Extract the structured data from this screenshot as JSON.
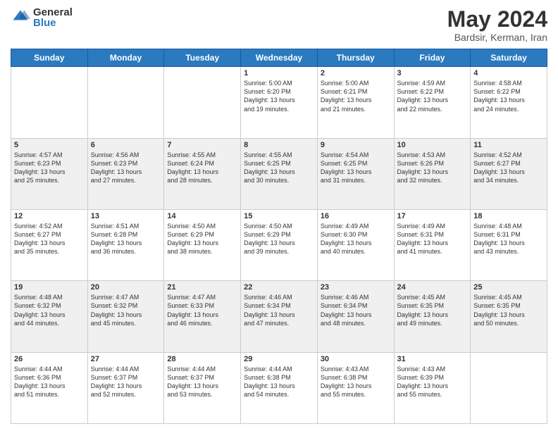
{
  "header": {
    "logo_general": "General",
    "logo_blue": "Blue",
    "month_title": "May 2024",
    "location": "Bardsir, Kerman, Iran"
  },
  "weekdays": [
    "Sunday",
    "Monday",
    "Tuesday",
    "Wednesday",
    "Thursday",
    "Friday",
    "Saturday"
  ],
  "weeks": [
    [
      {
        "day": "",
        "info": ""
      },
      {
        "day": "",
        "info": ""
      },
      {
        "day": "",
        "info": ""
      },
      {
        "day": "1",
        "info": "Sunrise: 5:00 AM\nSunset: 6:20 PM\nDaylight: 13 hours\nand 19 minutes."
      },
      {
        "day": "2",
        "info": "Sunrise: 5:00 AM\nSunset: 6:21 PM\nDaylight: 13 hours\nand 21 minutes."
      },
      {
        "day": "3",
        "info": "Sunrise: 4:59 AM\nSunset: 6:22 PM\nDaylight: 13 hours\nand 22 minutes."
      },
      {
        "day": "4",
        "info": "Sunrise: 4:58 AM\nSunset: 6:22 PM\nDaylight: 13 hours\nand 24 minutes."
      }
    ],
    [
      {
        "day": "5",
        "info": "Sunrise: 4:57 AM\nSunset: 6:23 PM\nDaylight: 13 hours\nand 25 minutes."
      },
      {
        "day": "6",
        "info": "Sunrise: 4:56 AM\nSunset: 6:23 PM\nDaylight: 13 hours\nand 27 minutes."
      },
      {
        "day": "7",
        "info": "Sunrise: 4:55 AM\nSunset: 6:24 PM\nDaylight: 13 hours\nand 28 minutes."
      },
      {
        "day": "8",
        "info": "Sunrise: 4:55 AM\nSunset: 6:25 PM\nDaylight: 13 hours\nand 30 minutes."
      },
      {
        "day": "9",
        "info": "Sunrise: 4:54 AM\nSunset: 6:25 PM\nDaylight: 13 hours\nand 31 minutes."
      },
      {
        "day": "10",
        "info": "Sunrise: 4:53 AM\nSunset: 6:26 PM\nDaylight: 13 hours\nand 32 minutes."
      },
      {
        "day": "11",
        "info": "Sunrise: 4:52 AM\nSunset: 6:27 PM\nDaylight: 13 hours\nand 34 minutes."
      }
    ],
    [
      {
        "day": "12",
        "info": "Sunrise: 4:52 AM\nSunset: 6:27 PM\nDaylight: 13 hours\nand 35 minutes."
      },
      {
        "day": "13",
        "info": "Sunrise: 4:51 AM\nSunset: 6:28 PM\nDaylight: 13 hours\nand 36 minutes."
      },
      {
        "day": "14",
        "info": "Sunrise: 4:50 AM\nSunset: 6:29 PM\nDaylight: 13 hours\nand 38 minutes."
      },
      {
        "day": "15",
        "info": "Sunrise: 4:50 AM\nSunset: 6:29 PM\nDaylight: 13 hours\nand 39 minutes."
      },
      {
        "day": "16",
        "info": "Sunrise: 4:49 AM\nSunset: 6:30 PM\nDaylight: 13 hours\nand 40 minutes."
      },
      {
        "day": "17",
        "info": "Sunrise: 4:49 AM\nSunset: 6:31 PM\nDaylight: 13 hours\nand 41 minutes."
      },
      {
        "day": "18",
        "info": "Sunrise: 4:48 AM\nSunset: 6:31 PM\nDaylight: 13 hours\nand 43 minutes."
      }
    ],
    [
      {
        "day": "19",
        "info": "Sunrise: 4:48 AM\nSunset: 6:32 PM\nDaylight: 13 hours\nand 44 minutes."
      },
      {
        "day": "20",
        "info": "Sunrise: 4:47 AM\nSunset: 6:32 PM\nDaylight: 13 hours\nand 45 minutes."
      },
      {
        "day": "21",
        "info": "Sunrise: 4:47 AM\nSunset: 6:33 PM\nDaylight: 13 hours\nand 46 minutes."
      },
      {
        "day": "22",
        "info": "Sunrise: 4:46 AM\nSunset: 6:34 PM\nDaylight: 13 hours\nand 47 minutes."
      },
      {
        "day": "23",
        "info": "Sunrise: 4:46 AM\nSunset: 6:34 PM\nDaylight: 13 hours\nand 48 minutes."
      },
      {
        "day": "24",
        "info": "Sunrise: 4:45 AM\nSunset: 6:35 PM\nDaylight: 13 hours\nand 49 minutes."
      },
      {
        "day": "25",
        "info": "Sunrise: 4:45 AM\nSunset: 6:35 PM\nDaylight: 13 hours\nand 50 minutes."
      }
    ],
    [
      {
        "day": "26",
        "info": "Sunrise: 4:44 AM\nSunset: 6:36 PM\nDaylight: 13 hours\nand 51 minutes."
      },
      {
        "day": "27",
        "info": "Sunrise: 4:44 AM\nSunset: 6:37 PM\nDaylight: 13 hours\nand 52 minutes."
      },
      {
        "day": "28",
        "info": "Sunrise: 4:44 AM\nSunset: 6:37 PM\nDaylight: 13 hours\nand 53 minutes."
      },
      {
        "day": "29",
        "info": "Sunrise: 4:44 AM\nSunset: 6:38 PM\nDaylight: 13 hours\nand 54 minutes."
      },
      {
        "day": "30",
        "info": "Sunrise: 4:43 AM\nSunset: 6:38 PM\nDaylight: 13 hours\nand 55 minutes."
      },
      {
        "day": "31",
        "info": "Sunrise: 4:43 AM\nSunset: 6:39 PM\nDaylight: 13 hours\nand 55 minutes."
      },
      {
        "day": "",
        "info": ""
      }
    ]
  ]
}
